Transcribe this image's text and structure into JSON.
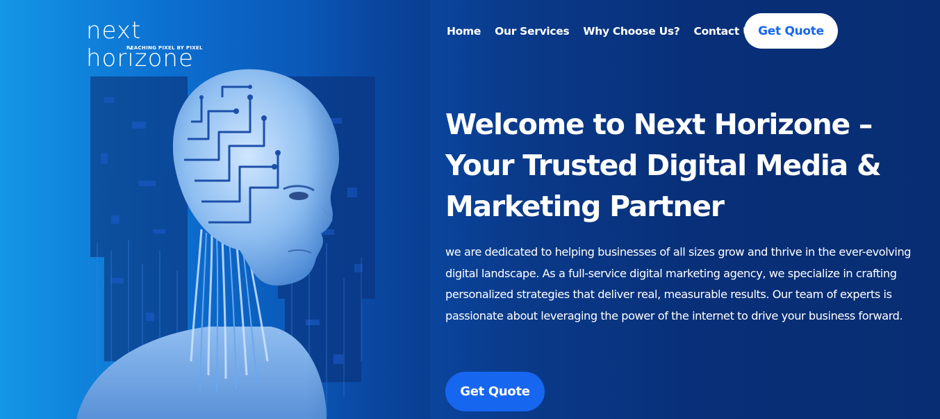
{
  "brand": {
    "logo_text": "next horizone",
    "tagline": "REACHING PIXEL BY PIXEL"
  },
  "nav": {
    "items": [
      {
        "label": "Home"
      },
      {
        "label": "Our Services"
      },
      {
        "label": "Why Choose Us?"
      },
      {
        "label": "Contact Us"
      }
    ],
    "cta_label": "Get Quote"
  },
  "hero": {
    "title": "Welcome to Next Horizone – Your Trusted Digital Media & Marketing Partner",
    "description": "we are dedicated to helping businesses of all sizes grow and thrive in the ever-evolving digital landscape. As a full-service digital marketing agency, we specialize in crafting personalized strategies that deliver real, measurable results. Our team of experts is passionate about leveraging the power of the internet to drive your business forward.",
    "cta_label": "Get Quote",
    "image": "ai-robot-head-illustration"
  },
  "colors": {
    "accent": "#1766f0",
    "background_dark": "#082d73",
    "background_light": "#1496e6",
    "text": "#ffffff"
  }
}
